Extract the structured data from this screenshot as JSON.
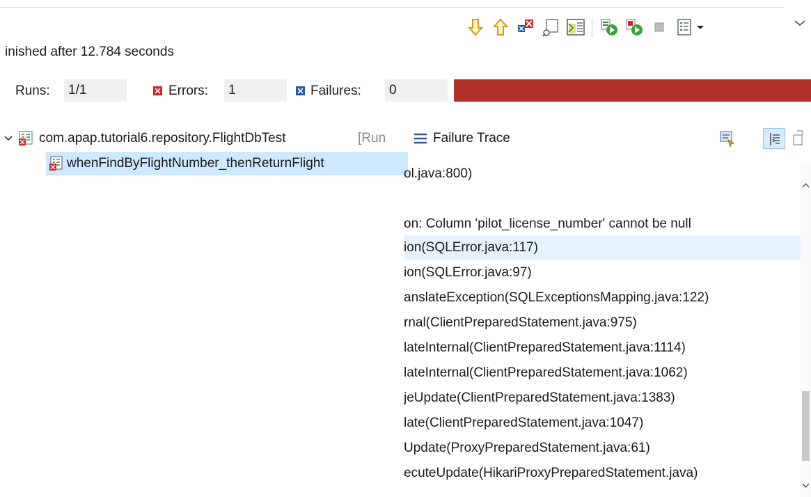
{
  "status": {
    "finished": "inished after 12.784 seconds"
  },
  "counters": {
    "runs_label": "Runs:",
    "runs_value": "1/1",
    "errors_label": "Errors:",
    "errors_value": "1",
    "failures_label": "Failures:",
    "failures_value": "0",
    "progress_color": "#b0302a"
  },
  "tree": {
    "suite_label": "com.apap.tutorial6.repository.FlightDbTest",
    "suite_suffix": "[Run",
    "test_label": "whenFindByFlightNumber_thenReturnFlight"
  },
  "trace": {
    "title": "Failure Trace",
    "lines": [
      "ol.java:800)",
      "",
      "on: Column 'pilot_license_number' cannot be null",
      "ion(SQLError.java:117)",
      "ion(SQLError.java:97)",
      "anslateException(SQLExceptionsMapping.java:122)",
      "rnal(ClientPreparedStatement.java:975)",
      "lateInternal(ClientPreparedStatement.java:1114)",
      "lateInternal(ClientPreparedStatement.java:1062)",
      "jeUpdate(ClientPreparedStatement.java:1383)",
      "late(ClientPreparedStatement.java:1047)",
      "Update(ProxyPreparedStatement.java:61)",
      "ecuteUpdate(HikariProxyPreparedStatement.java)"
    ]
  },
  "icons": {
    "toolbar": [
      "next-failure-icon",
      "previous-failure-icon",
      "show-failures-only-icon",
      "scroll-lock-icon",
      "layout-icon",
      "rerun-test-icon",
      "rerun-failed-first-icon",
      "stop-icon",
      "history-icon",
      "dropdown-icon",
      "view-menu-icon"
    ]
  }
}
